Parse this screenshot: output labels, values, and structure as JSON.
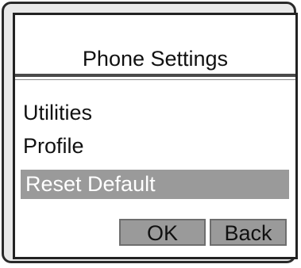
{
  "screen": {
    "title": "Phone Settings"
  },
  "menu": {
    "items": [
      {
        "label": "Utilities",
        "selected": false
      },
      {
        "label": "Profile",
        "selected": false
      },
      {
        "label": "Reset Default",
        "selected": true
      }
    ]
  },
  "softkeys": {
    "ok_label": "OK",
    "back_label": "Back"
  },
  "colors": {
    "selection_highlight": "#9a9a9a",
    "selection_text": "#ffffff",
    "button_fill": "#9a9a9a",
    "frame": "#222222"
  }
}
